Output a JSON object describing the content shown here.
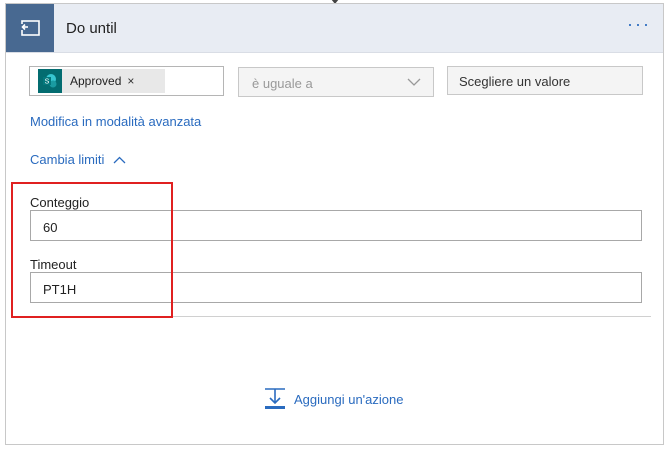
{
  "header": {
    "title": "Do until",
    "more_label": "···"
  },
  "condition": {
    "token_label": "Approved",
    "token_close": "×",
    "operator_value": "è uguale a",
    "value_placeholder": "Scegliere un valore"
  },
  "links": {
    "advanced_mode": "Modifica in modalità avanzata",
    "change_limits": "Cambia limiti"
  },
  "limits": {
    "count_label": "Conteggio",
    "count_value": "60",
    "timeout_label": "Timeout",
    "timeout_value": "PT1H"
  },
  "add_action": {
    "label": "Aggiungi un'azione"
  },
  "colors": {
    "header_icon_bg": "#486991",
    "link": "#2a6bbf",
    "highlight": "#e02020",
    "token_icon_bg": "#036c70"
  }
}
